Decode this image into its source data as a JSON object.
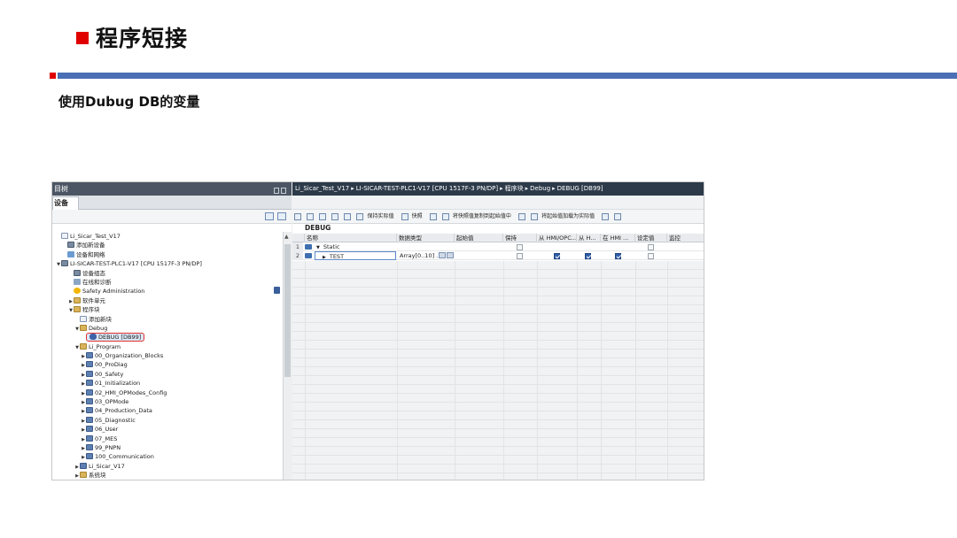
{
  "slide": {
    "title": "程序短接",
    "subtitle": "使用Dubug DB的变量"
  },
  "left_pane": {
    "header": "目树",
    "tab": "设备",
    "tree": [
      {
        "label": "Li_Sicar_Test_V17",
        "level": 0,
        "arrow": "",
        "icon": "page"
      },
      {
        "label": "添加新设备",
        "level": 1,
        "arrow": "",
        "icon": "dev"
      },
      {
        "label": "设备和网络",
        "level": 1,
        "arrow": "",
        "icon": "net"
      },
      {
        "label": "LI-SICAR-TEST-PLC1-V17 [CPU 1517F-3 PN/DP]",
        "level": 0,
        "arrow": "▼",
        "icon": "dev"
      },
      {
        "label": "设备组态",
        "level": 2,
        "arrow": "",
        "icon": "dev"
      },
      {
        "label": "在线和诊断",
        "level": 2,
        "arrow": "",
        "icon": "online"
      },
      {
        "label": "Safety Administration",
        "level": 2,
        "arrow": "",
        "icon": "safety"
      },
      {
        "label": "软件单元",
        "level": 2,
        "arrow": "▶",
        "icon": "folder"
      },
      {
        "label": "程序块",
        "level": 2,
        "arrow": "▼",
        "icon": "folder"
      },
      {
        "label": "添加新块",
        "level": 3,
        "arrow": "",
        "icon": "page"
      },
      {
        "label": "Debug",
        "level": 3,
        "arrow": "▼",
        "icon": "folder"
      },
      {
        "label": "DEBUG [DB99]",
        "level": 4,
        "arrow": "",
        "icon": "db",
        "selected": true
      },
      {
        "label": "Li_Program",
        "level": 3,
        "arrow": "▼",
        "icon": "folder"
      },
      {
        "label": "00_Organization_Blocks",
        "level": 4,
        "arrow": "▶",
        "icon": "block"
      },
      {
        "label": "00_ProDiag",
        "level": 4,
        "arrow": "▶",
        "icon": "block"
      },
      {
        "label": "00_Safety",
        "level": 4,
        "arrow": "▶",
        "icon": "block"
      },
      {
        "label": "01_Initialization",
        "level": 4,
        "arrow": "▶",
        "icon": "block"
      },
      {
        "label": "02_HMI_OPModes_Config",
        "level": 4,
        "arrow": "▶",
        "icon": "block"
      },
      {
        "label": "03_OPMode",
        "level": 4,
        "arrow": "▶",
        "icon": "block"
      },
      {
        "label": "04_Production_Data",
        "level": 4,
        "arrow": "▶",
        "icon": "block"
      },
      {
        "label": "05_Diagnostic",
        "level": 4,
        "arrow": "▶",
        "icon": "block"
      },
      {
        "label": "06_User",
        "level": 4,
        "arrow": "▶",
        "icon": "block"
      },
      {
        "label": "07_MES",
        "level": 4,
        "arrow": "▶",
        "icon": "block"
      },
      {
        "label": "99_PNPN",
        "level": 4,
        "arrow": "▶",
        "icon": "block"
      },
      {
        "label": "100_Communication",
        "level": 4,
        "arrow": "▶",
        "icon": "block"
      },
      {
        "label": "Li_Sicar_V17",
        "level": 3,
        "arrow": "▶",
        "icon": "block"
      },
      {
        "label": "系统块",
        "level": 3,
        "arrow": "▶",
        "icon": "folder"
      }
    ]
  },
  "right_pane": {
    "breadcrumb": [
      "Li_Sicar_Test_V17",
      "LI-SICAR-TEST-PLC1-V17 [CPU 1517F-3 PN/DP]",
      "程序块",
      "Debug",
      "DEBUG [DB99]"
    ],
    "breadcrumb_sep": "▸",
    "toolbar": {
      "keep_actual": "保持实际值",
      "snapshot": "快照",
      "copy_snapshot": "将快照值复制到起始值中",
      "load_start": "将起始值加载为实际值"
    },
    "db_title": "DEBUG",
    "columns": [
      "",
      "名称",
      "数据类型",
      "起始值",
      "保持",
      "从 HMI/OPC...",
      "从 H...",
      "在 HMI ...",
      "设定值",
      "监控"
    ],
    "rows": [
      {
        "num": "1",
        "expander": "▼",
        "name": "Static",
        "type": "",
        "start": "",
        "retain": false,
        "hmi_access": null,
        "hmi_write": null,
        "hmi_visible": null,
        "setpoint": false
      },
      {
        "num": "2",
        "expander": "▶",
        "name": "TEST",
        "type": "Array[0..10] ...",
        "start": "",
        "retain": false,
        "hmi_access": true,
        "hmi_write": true,
        "hmi_visible": true,
        "setpoint": false
      }
    ]
  }
}
